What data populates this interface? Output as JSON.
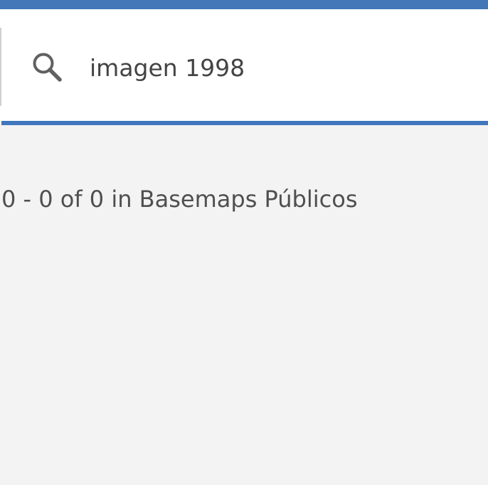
{
  "search": {
    "value": "imagen 1998",
    "icon": "search-icon"
  },
  "results": {
    "summary": "0 - 0 of 0 in Basemaps Públicos"
  },
  "colors": {
    "accent": "#4377b8",
    "focus_underline": "#3f76bd",
    "background": "#f3f3f3",
    "panel": "#ffffff",
    "text": "#4f4f4f"
  }
}
